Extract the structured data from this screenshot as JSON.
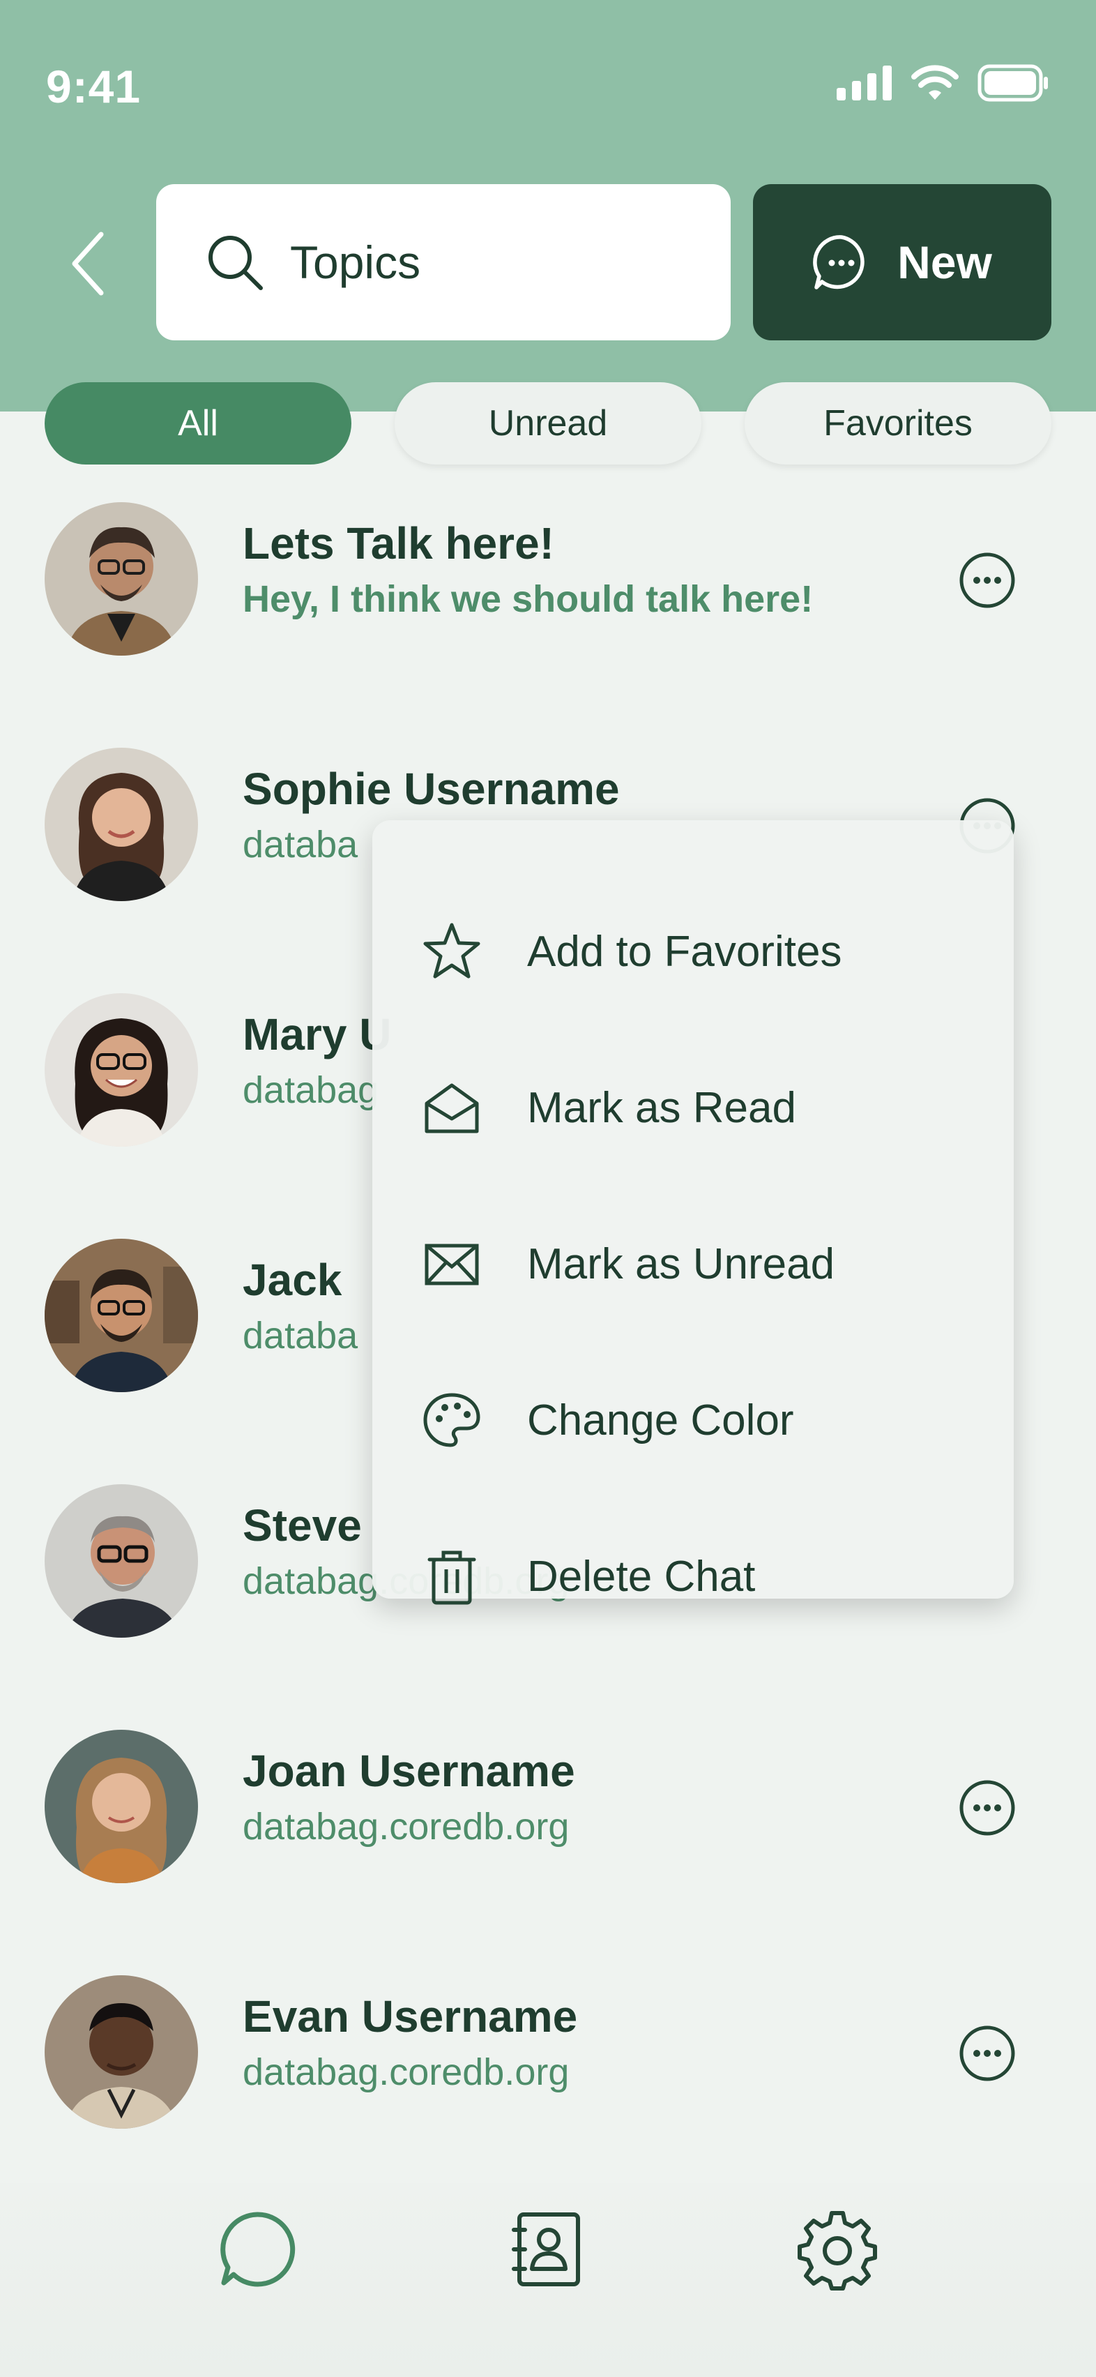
{
  "status_bar": {
    "time": "9:41"
  },
  "search": {
    "text": "Topics"
  },
  "new_button": {
    "label": "New"
  },
  "filters": {
    "all": "All",
    "unread": "Unread",
    "favorites": "Favorites"
  },
  "chats": [
    {
      "name": "Lets Talk here!",
      "subtitle": "Hey, I think we should talk here!"
    },
    {
      "name": "Sophie Username",
      "subtitle": "databa"
    },
    {
      "name": "Mary U",
      "subtitle": "databag"
    },
    {
      "name": "Jack",
      "subtitle": "databa"
    },
    {
      "name": "Steve",
      "subtitle": "databag.coredb.org"
    },
    {
      "name": "Joan Username",
      "subtitle": "databag.coredb.org"
    },
    {
      "name": "Evan  Username",
      "subtitle": "databag.coredb.org"
    }
  ],
  "context_menu": {
    "items": [
      {
        "label": "Add to Favorites",
        "icon": "star-icon"
      },
      {
        "label": "Mark as Read",
        "icon": "envelope-open-icon"
      },
      {
        "label": "Mark as Unread",
        "icon": "envelope-icon"
      },
      {
        "label": "Change Color",
        "icon": "palette-icon"
      },
      {
        "label": "Delete Chat",
        "icon": "trash-icon"
      }
    ]
  },
  "tab_bar": {
    "items": [
      {
        "icon": "chat-bubble-icon"
      },
      {
        "icon": "contacts-book-icon"
      },
      {
        "icon": "gear-icon"
      }
    ]
  },
  "colors": {
    "header": "#8fbfa6",
    "background": "#eff3f0",
    "primary_dark": "#244635",
    "accent": "#468a64",
    "text": "#1f3d2f",
    "subtitle": "#4e8d6a"
  }
}
